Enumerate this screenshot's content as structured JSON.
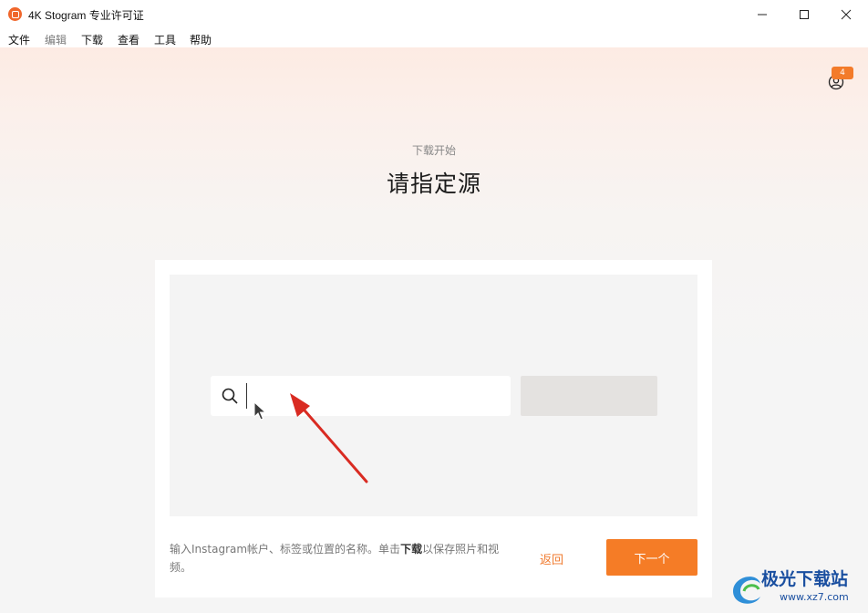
{
  "window": {
    "title": "4K Stogram 专业许可证"
  },
  "menu": {
    "items": [
      {
        "label": "文件",
        "enabled": true
      },
      {
        "label": "编辑",
        "enabled": false
      },
      {
        "label": "下载",
        "enabled": true
      },
      {
        "label": "查看",
        "enabled": true
      },
      {
        "label": "工具",
        "enabled": true
      },
      {
        "label": "帮助",
        "enabled": true
      }
    ]
  },
  "account": {
    "icon": "user-circle-icon",
    "badge_count": "4"
  },
  "header": {
    "subtitle": "下载开始",
    "title": "请指定源"
  },
  "search": {
    "value": "",
    "placeholder": ""
  },
  "download_button": {
    "label": ""
  },
  "footer": {
    "hint_before": "输入Instagram帐户、标签或位置的名称。单击",
    "hint_bold": "下载",
    "hint_after": "以保存照片和视频。",
    "back_label": "返回",
    "next_label": "下一个"
  },
  "watermark": {
    "name": "极光下载站",
    "url": "www.xz7.com"
  },
  "colors": {
    "accent": "#f57c26",
    "app_icon": "#f0662b",
    "annotation_arrow": "#d92b22"
  }
}
